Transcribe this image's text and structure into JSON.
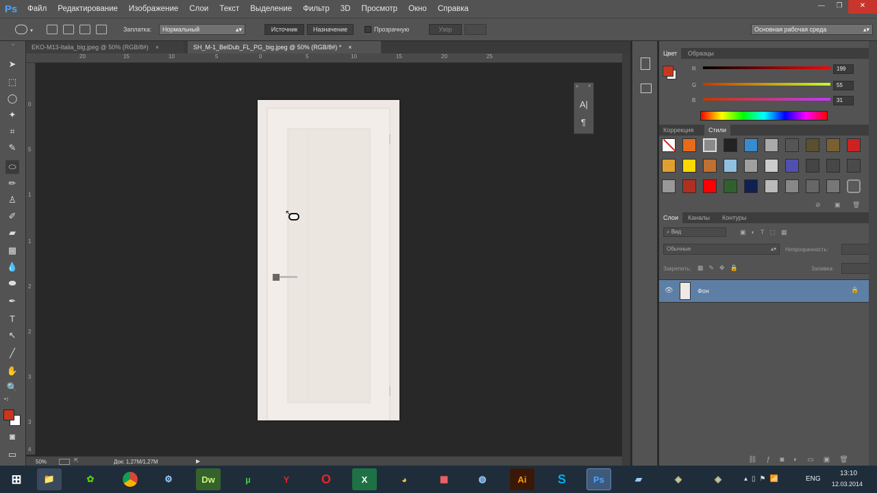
{
  "app": {
    "logo": "Ps"
  },
  "menu": [
    "Файл",
    "Редактирование",
    "Изображение",
    "Слои",
    "Текст",
    "Выделение",
    "Фильтр",
    "3D",
    "Просмотр",
    "Окно",
    "Справка"
  ],
  "window_controls": {
    "minimize": "—",
    "restore": "❐",
    "close": "✕"
  },
  "options": {
    "patch_label": "Заплатка:",
    "patch_mode": "Нормальный",
    "source_btn": "Источник",
    "dest_btn": "Назначение",
    "transparent_label": "Прозрачную",
    "pattern_btn": "Узор",
    "workspace": "Основная рабочая среда"
  },
  "doc_tabs": [
    {
      "label": "EKO-M13-Italia_big.jpeg @ 50% (RGB/8#)",
      "close": "×"
    },
    {
      "label": "SH_M-1_BelDub_FL_PG_big.jpeg @ 50% (RGB/8#) *",
      "close": "×"
    }
  ],
  "rulers": {
    "top": [
      "20",
      "15",
      "10",
      "5",
      "0",
      "5",
      "10",
      "15",
      "20",
      "25"
    ],
    "left": [
      "0",
      "5",
      "1",
      "1",
      "2",
      "2",
      "3",
      "3",
      "4"
    ]
  },
  "status": {
    "zoom": "50%",
    "doc": "Док: 1,27M/1,27M"
  },
  "mini_panel": {
    "char_icon": "A|",
    "para_icon": "¶"
  },
  "color_panel": {
    "tabs": [
      "Цвет",
      "Образцы"
    ],
    "channels": [
      {
        "label": "R",
        "value": "199"
      },
      {
        "label": "G",
        "value": "55"
      },
      {
        "label": "B",
        "value": "31"
      }
    ],
    "fg_color": "#c7371f",
    "bg_color": "#ffffff"
  },
  "styles_panel": {
    "tabs": [
      "Коррекция",
      "Стили"
    ]
  },
  "layers_panel": {
    "tabs": [
      "Слои",
      "Каналы",
      "Контуры"
    ],
    "filter_kind": "Вид",
    "blend_mode": "Обычные",
    "opacity_label": "Непрозрачность:",
    "lock_label": "Закрепить:",
    "fill_label": "Заливка:",
    "layer_name": "Фон"
  },
  "taskbar": {
    "apps": [
      "Dw",
      "Ai",
      "Ps"
    ],
    "lang": "ENG",
    "time": "13:10",
    "date": "12.03.2014"
  }
}
